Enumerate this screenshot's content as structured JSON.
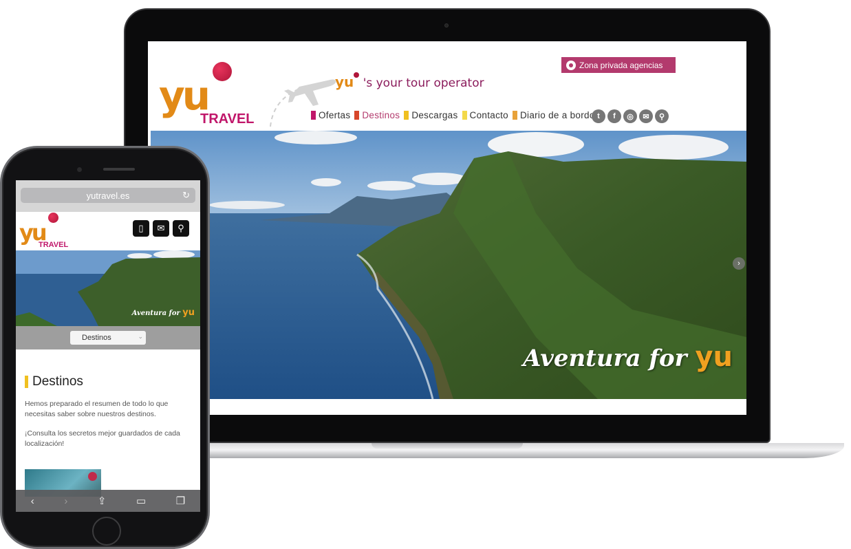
{
  "desktop": {
    "logo": {
      "yu": "yu",
      "travel": "TRAVEL"
    },
    "tagline": {
      "yu": "yu",
      "text": "'s your tour operator"
    },
    "agency_button": "Zona privada agencias",
    "nav": [
      {
        "label": "Ofertas",
        "color": "#c0166a"
      },
      {
        "label": "Destinos",
        "color": "#d7462a",
        "active": true
      },
      {
        "label": "Descargas",
        "color": "#f0c020"
      },
      {
        "label": "Contacto",
        "color": "#f3d94a"
      },
      {
        "label": "Diario de a bordo",
        "color": "#e8a23a"
      }
    ],
    "social_icons": [
      "twitter-icon",
      "facebook-icon",
      "instagram-icon",
      "mail-icon",
      "location-icon"
    ],
    "hero_slogan": {
      "text": "Aventura for ",
      "yu": "yu"
    }
  },
  "mobile": {
    "url": "yutravel.es",
    "logo": {
      "yu": "yu",
      "travel": "TRAVEL"
    },
    "header_icons": [
      "phone-icon",
      "mail-icon",
      "location-icon"
    ],
    "hero_slogan": {
      "text": "Aventura for ",
      "yu": "yu"
    },
    "select_value": "Destinos",
    "section_title": "Destinos",
    "paragraph1": "Hemos preparado el resumen de todo lo que necesitas saber sobre nuestros destinos.",
    "paragraph2": "¡Consulta los secretos mejor guardados de cada localización!",
    "toolbar": [
      "back-icon",
      "forward-icon",
      "share-icon",
      "bookmarks-icon",
      "tabs-icon"
    ]
  }
}
